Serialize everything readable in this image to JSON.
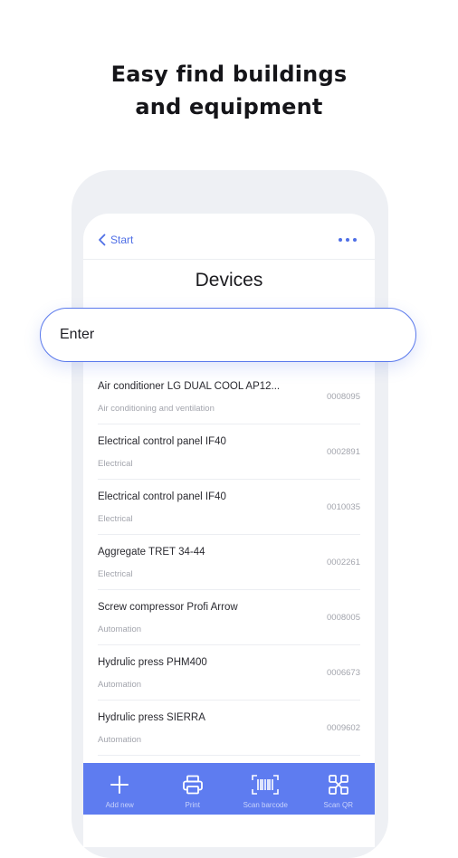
{
  "headline": {
    "line1": "Easy find buildings",
    "line2": "and equipment"
  },
  "nav": {
    "back_label": "Start",
    "more_icon": "more-dots-icon"
  },
  "page": {
    "title": "Devices"
  },
  "search": {
    "placeholder": "Enter"
  },
  "devices": [
    {
      "name": "Air conditioner LG DUAL COOL AP12...",
      "category": "Air conditioning and ventilation",
      "code": "0008095"
    },
    {
      "name": "Electrical control panel IF40",
      "category": "Electrical",
      "code": "0002891"
    },
    {
      "name": "Electrical control panel IF40",
      "category": "Electrical",
      "code": "0010035"
    },
    {
      "name": "Aggregate TRET 34-44",
      "category": "Electrical",
      "code": "0002261"
    },
    {
      "name": "Screw compressor Profi Arrow",
      "category": "Automation",
      "code": "0008005"
    },
    {
      "name": "Hydrulic press PHM400",
      "category": "Automation",
      "code": "0006673"
    },
    {
      "name": "Hydrulic press SIERRA",
      "category": "Automation",
      "code": "0009602"
    }
  ],
  "toolbar": {
    "items": [
      {
        "label": "Add new",
        "icon": "plus-icon"
      },
      {
        "label": "Print",
        "icon": "printer-icon"
      },
      {
        "label": "Scan barcode",
        "icon": "barcode-icon"
      },
      {
        "label": "Scan QR",
        "icon": "qr-icon"
      }
    ]
  },
  "colors": {
    "accent": "#5e7cf0",
    "link": "#4f6fe6",
    "muted": "#a3a5ad"
  }
}
